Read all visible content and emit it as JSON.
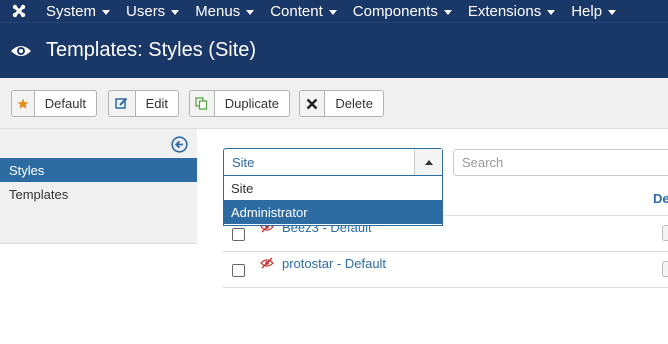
{
  "navbar": {
    "logo_icon": "joomla-logo-icon",
    "menus": [
      {
        "label": "System"
      },
      {
        "label": "Users"
      },
      {
        "label": "Menus"
      },
      {
        "label": "Content"
      },
      {
        "label": "Components"
      },
      {
        "label": "Extensions"
      },
      {
        "label": "Help"
      }
    ]
  },
  "header": {
    "icon": "eye-icon",
    "title": "Templates: Styles (Site)"
  },
  "toolbar": {
    "default_label": "Default",
    "edit_label": "Edit",
    "duplicate_label": "Duplicate",
    "delete_label": "Delete"
  },
  "sidebar": {
    "collapse_icon": "arrow-left-circle-icon",
    "items": [
      {
        "label": "Styles",
        "active": true
      },
      {
        "label": "Templates",
        "active": false
      }
    ]
  },
  "filter": {
    "selected": "Site",
    "options": [
      "Site",
      "Administrator"
    ],
    "highlighted": "Administrator"
  },
  "search": {
    "placeholder": "Search"
  },
  "table": {
    "default_header": "De",
    "rows": [
      {
        "name": "Beez3 - Default"
      },
      {
        "name": "protostar - Default"
      }
    ]
  },
  "colors": {
    "navbar_bg": "#1a3867",
    "accent": "#2d6ca2",
    "star": "#e68a19",
    "hidden_icon": "#c9302c"
  }
}
